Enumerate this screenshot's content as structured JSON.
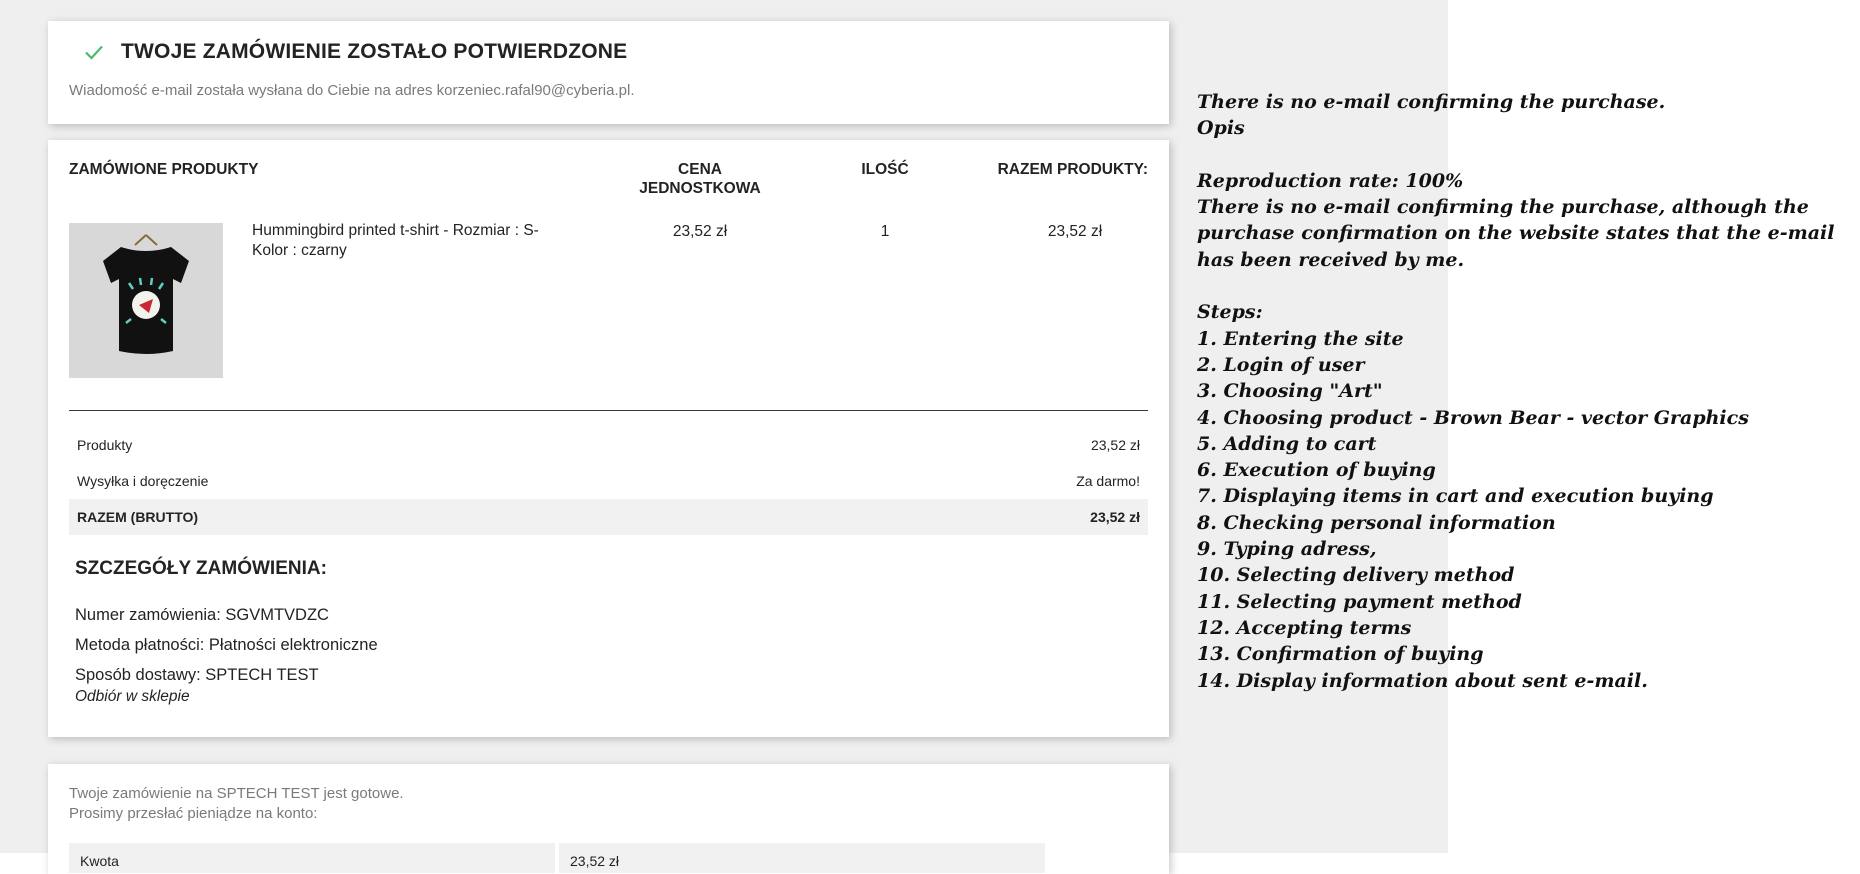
{
  "confirmation": {
    "title": "TWOJE ZAMÓWIENIE ZOSTAŁO POTWIERDZONE",
    "subtitle": "Wiadomość e-mail została wysłana do Ciebie na adres korzeniec.rafal90@cyberia.pl."
  },
  "products_table": {
    "headers": {
      "product": "ZAMÓWIONE PRODUKTY",
      "unit_price_line1": "CENA",
      "unit_price_line2": "JEDNOSTKOWA",
      "quantity": "ILOŚĆ",
      "total": "RAZEM PRODUKTY:"
    },
    "items": [
      {
        "name_line1": "Hummingbird printed t-shirt - Rozmiar : S-",
        "name_line2": "Kolor : czarny",
        "unit_price": "23,52 zł",
        "quantity": "1",
        "total": "23,52 zł"
      }
    ]
  },
  "summary": {
    "products_label": "Produkty",
    "products_value": "23,52 zł",
    "shipping_label": "Wysyłka i doręczenie",
    "shipping_value": "Za darmo!",
    "total_label": "RAZEM (BRUTTO)",
    "total_value": "23,52 zł"
  },
  "details": {
    "title": "SZCZEGÓŁY ZAMÓWIENIA:",
    "order_number": "Numer zamówienia: SGVMTVDZC",
    "payment_method": "Metoda płatności: Płatności elektroniczne",
    "delivery_method": "Sposób dostawy: SPTECH TEST",
    "delivery_note": "Odbiór w sklepie"
  },
  "bank": {
    "line1": "Twoje zamówienie na SPTECH TEST jest gotowe.",
    "line2": "Prosimy przesłać pieniądze na konto:",
    "table_label": "Kwota",
    "table_value": "23,52 zł"
  },
  "bug_report": {
    "lines": [
      "There is no e-mail confirming the purchase.",
      "Opis",
      "",
      "Reproduction rate: 100%",
      "There is no e-mail confirming the purchase, although the",
      "purchase confirmation on the website states that the e-mail",
      "has been received by me.",
      "",
      "Steps:",
      "1. Entering the site",
      "2. Login of user",
      "3. Choosing \"Art\"",
      "4. Choosing product - Brown Bear - vector Graphics",
      "5. Adding to cart",
      "6. Execution of buying",
      "7. Displaying items in cart and execution buying",
      "8. Checking personal information",
      "9. Typing adress,",
      "10. Selecting delivery method",
      "11. Selecting payment method",
      "12. Accepting terms",
      "13. Confirmation of buying",
      "14. Display information about sent e-mail."
    ]
  },
  "colors": {
    "page_background": "#efefef",
    "card_background": "#ffffff",
    "check_green": "#4cbb6c",
    "total_row_bg": "#f1f1f1"
  }
}
